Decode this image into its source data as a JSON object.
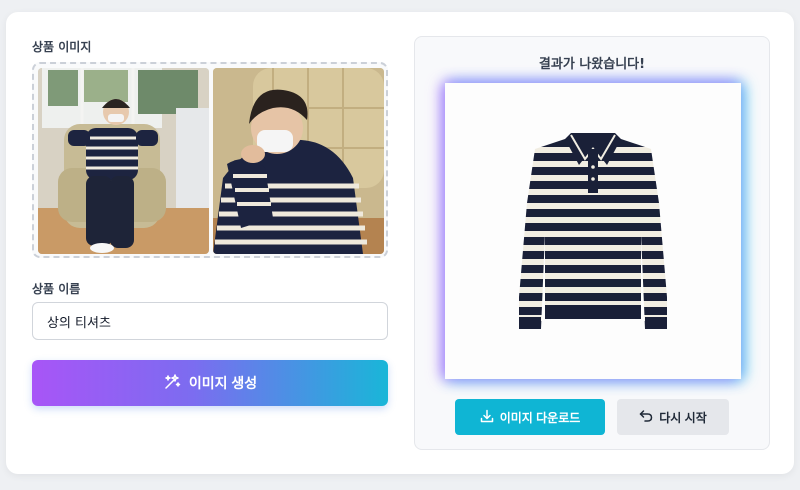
{
  "form": {
    "images_label": "상품 이미지",
    "name_label": "상품 이름",
    "name_value": "상의 티셔츠",
    "generate_label": "이미지 생성"
  },
  "result": {
    "title": "결과가 나왔습니다!",
    "download_label": "이미지 다운로드",
    "restart_label": "다시 시작"
  },
  "icons": {
    "generate": "sparkle-wand-icon",
    "download": "download-icon",
    "restart": "undo-arrow-icon"
  },
  "colors": {
    "gradient_start": "#a855f7",
    "gradient_end": "#19b6d8",
    "download_bg": "#0fb5d4",
    "restart_bg": "#e5e7eb"
  }
}
